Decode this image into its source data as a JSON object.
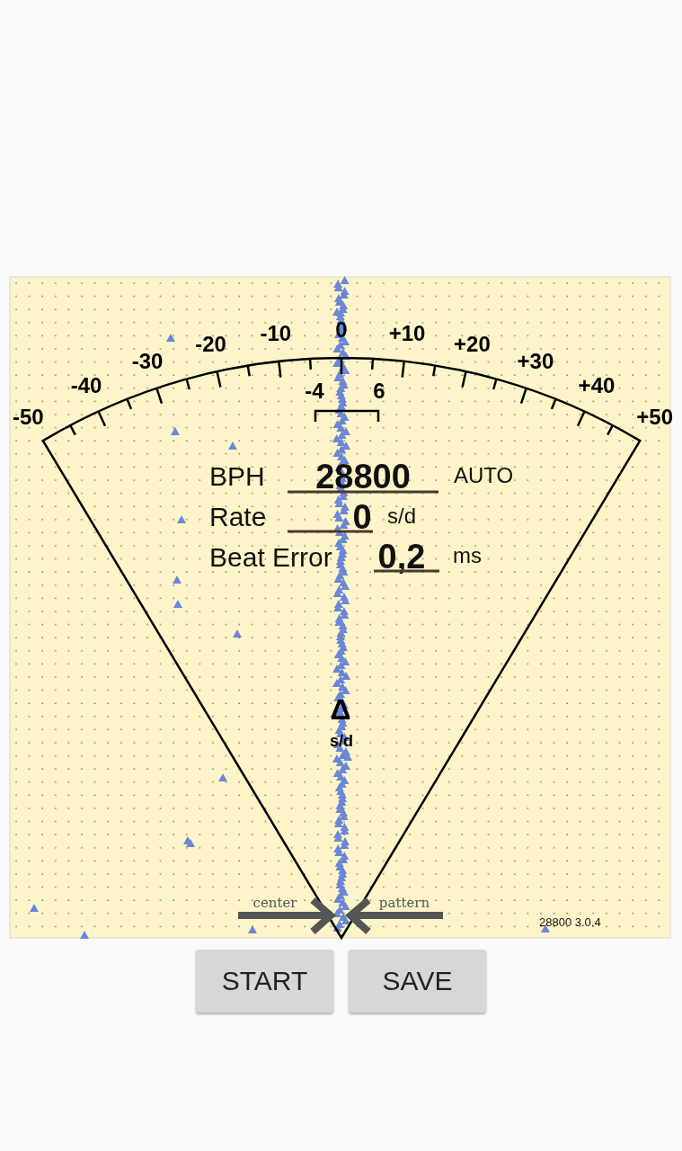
{
  "gauge": {
    "scale_labels": [
      "-50",
      "-40",
      "-30",
      "-20",
      "-10",
      "0",
      "+10",
      "+20",
      "+30",
      "+40",
      "+50"
    ],
    "inner_labels": [
      "-4",
      "6"
    ],
    "delta_symbol": "Δ",
    "delta_unit": "s/d"
  },
  "readouts": [
    {
      "label": "BPH",
      "value": "28800",
      "unit": "AUTO"
    },
    {
      "label": "Rate",
      "value": "0",
      "unit": "s/d"
    },
    {
      "label": "Beat Error",
      "value": "0,2",
      "unit": "ms"
    }
  ],
  "markers": {
    "left": "center",
    "right": "pattern"
  },
  "version": "28800 3.0.4",
  "buttons": [
    "START",
    "SAVE"
  ]
}
